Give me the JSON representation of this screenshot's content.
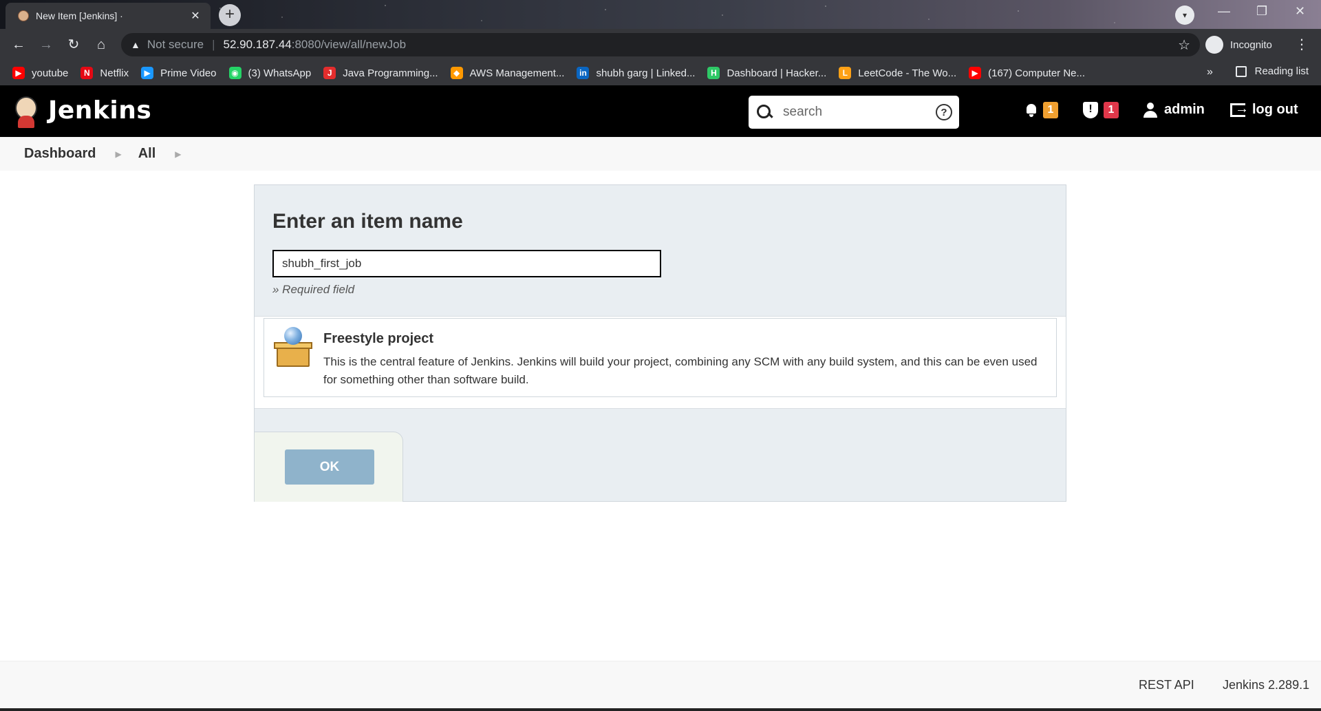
{
  "browser": {
    "tab_title": "New Item [Jenkins] ·",
    "tab_close": "✕",
    "new_tab": "+",
    "address": {
      "security": "Not secure",
      "host": "52.90.187.44",
      "path": ":8080/view/all/newJob"
    },
    "profile": "Incognito",
    "bookmarks": [
      {
        "label": "youtube",
        "icon": "youtube-icon",
        "color": "#ff0000"
      },
      {
        "label": "Netflix",
        "icon": "netflix-icon",
        "color": "#e50914"
      },
      {
        "label": "Prime Video",
        "icon": "prime-video-icon",
        "color": "#1a98ff"
      },
      {
        "label": "(3) WhatsApp",
        "icon": "whatsapp-icon",
        "color": "#25d366"
      },
      {
        "label": "Java Programming...",
        "icon": "java-icon",
        "color": "#e32d2d"
      },
      {
        "label": "AWS Management...",
        "icon": "aws-icon",
        "color": "#ff9900"
      },
      {
        "label": "shubh garg | Linked...",
        "icon": "linkedin-icon",
        "color": "#0a66c2"
      },
      {
        "label": "Dashboard | Hacker...",
        "icon": "hackerrank-icon",
        "color": "#2ec866"
      },
      {
        "label": "LeetCode - The Wo...",
        "icon": "leetcode-icon",
        "color": "#ffa116"
      },
      {
        "label": "(167) Computer Ne...",
        "icon": "youtube-icon",
        "color": "#ff0000"
      }
    ],
    "more_bookmarks": "»",
    "reading_list": "Reading list"
  },
  "jenkins": {
    "app_name": "Jenkins",
    "search": {
      "placeholder": "search",
      "help": "?"
    },
    "notifications_count": "1",
    "security_count": "1",
    "user": "admin",
    "logout": "log out",
    "colors": {
      "notification_badge": "#f0a030",
      "security_badge": "#e0374a"
    }
  },
  "breadcrumb": {
    "items": [
      "Dashboard",
      "All"
    ],
    "separator": "›"
  },
  "form": {
    "heading": "Enter an item name",
    "item_name_value": "shubh_first_job",
    "required_note": "» Required field",
    "options": [
      {
        "title": "Freestyle project",
        "description": "This is the central feature of Jenkins. Jenkins will build your project, combining any SCM with any build system, and this can be even used for something other than software build.",
        "icon": "freestyle-project-icon"
      }
    ],
    "ok_label": "OK"
  },
  "footer": {
    "rest_api": "REST API",
    "version": "Jenkins 2.289.1"
  }
}
